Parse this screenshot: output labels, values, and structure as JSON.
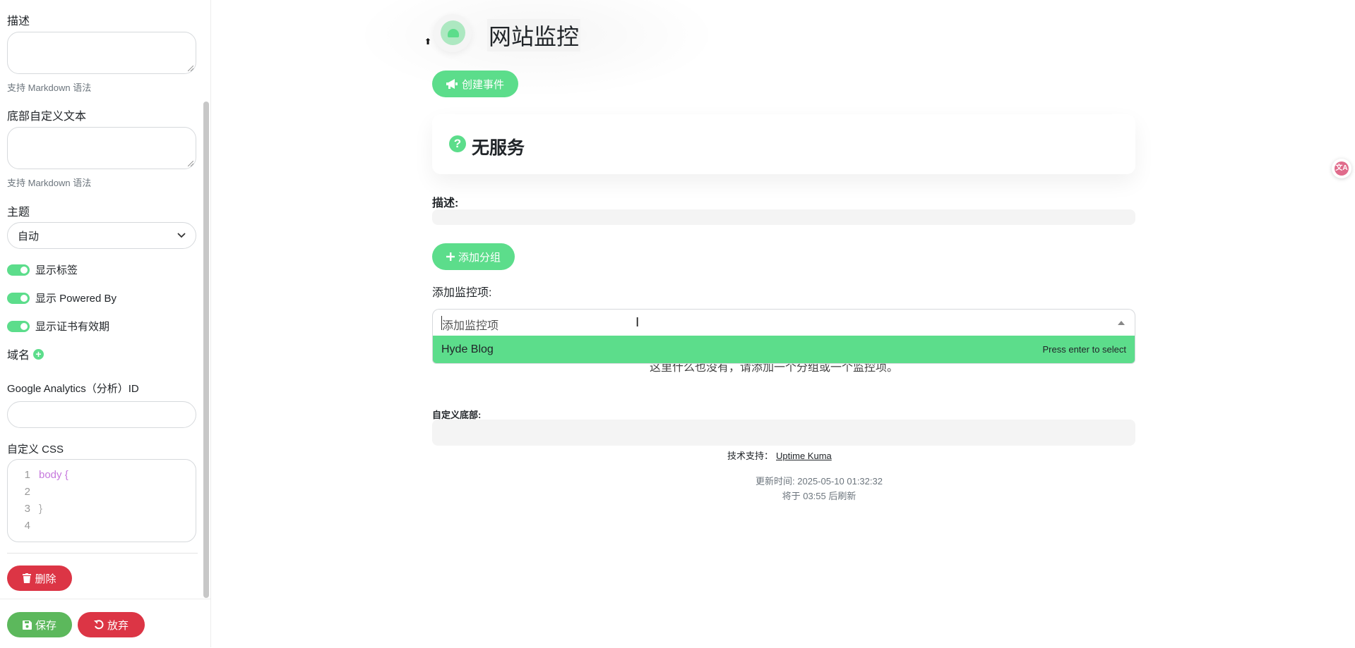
{
  "sidebar": {
    "description_label": "描述",
    "description_hint": "支持 Markdown 语法",
    "footer_text_label": "底部自定义文本",
    "footer_text_hint": "支持 Markdown 语法",
    "theme_label": "主题",
    "theme_value": "自动",
    "toggles": [
      {
        "label": "显示标签",
        "on": true
      },
      {
        "label": "显示 Powered By",
        "on": true
      },
      {
        "label": "显示证书有效期",
        "on": true
      }
    ],
    "domain_label": "域名",
    "ga_label": "Google Analytics（分析）ID",
    "ga_value": "",
    "css_label": "自定义 CSS",
    "css_lines": [
      {
        "num": "1",
        "text": "body {"
      },
      {
        "num": "2",
        "text": ""
      },
      {
        "num": "3",
        "text": "}"
      },
      {
        "num": "4",
        "text": ""
      }
    ],
    "delete_label": "删除",
    "save_label": "保存",
    "discard_label": "放弃"
  },
  "main": {
    "title": "网站监控",
    "create_incident_label": "创建事件",
    "status_title": "无服务",
    "description_label": "描述:",
    "add_group_label": "添加分组",
    "add_monitor_label": "添加监控项:",
    "monitor_search": {
      "placeholder": "添加监控项",
      "option": "Hyde Blog",
      "option_hint": "Press enter to select"
    },
    "empty_hint": "这里什么也没有，请添加一个分组或一个监控项。",
    "custom_footer_label": "自定义底部:",
    "powered_by_prefix": "技术支持：",
    "powered_by_link": "Uptime Kuma",
    "update_time": "更新时间: 2025-05-10 01:32:32",
    "refresh_text": "将于 03:55 后刷新"
  },
  "colors": {
    "primary": "#5cdd8b",
    "danger": "#dc3545",
    "success": "#5cb85c"
  }
}
